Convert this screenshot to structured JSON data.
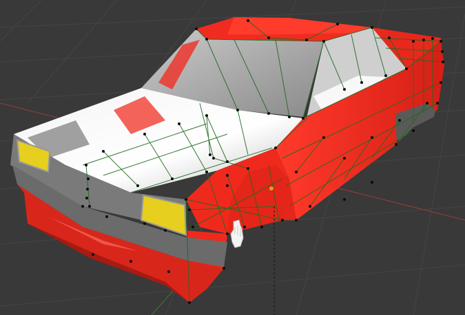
{
  "viewport": {
    "mode": "edit-mode",
    "background_color": "#393939",
    "grid_color": "#454545",
    "axis_x_color": "#9a3a3a",
    "axis_y_color": "#3c7a3c",
    "object": {
      "type": "car-body-mesh",
      "body_color": "#ee2d22",
      "glass_color": "#d8d8d8",
      "headlight_color": "#e6cf1e",
      "bumper_color": "#6f6f6f",
      "wire_color": "#1f6a1f",
      "vertex_color": "#0a0a0a",
      "origin_color": "#e0a020"
    },
    "gizmo": {
      "icon": "hand-grab-icon"
    }
  }
}
